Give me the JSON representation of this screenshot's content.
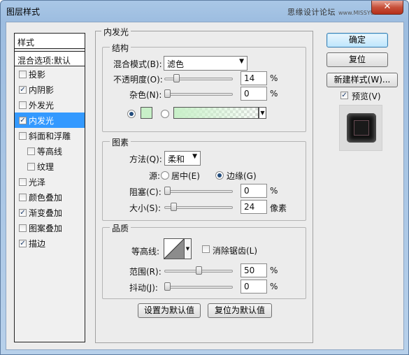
{
  "window": {
    "title": "图层样式",
    "watermark": "思缘设计论坛",
    "watermark_sub": "www.MISSYUAN.COM",
    "close_glyph": "✕"
  },
  "sidebar": {
    "header": "样式",
    "blend_header": "混合选项:默认",
    "items": [
      {
        "label": "投影",
        "checked": false,
        "selected": false,
        "check": ""
      },
      {
        "label": "内阴影",
        "checked": true,
        "selected": false,
        "check": "✓"
      },
      {
        "label": "外发光",
        "checked": false,
        "selected": false,
        "check": ""
      },
      {
        "label": "内发光",
        "checked": true,
        "selected": true,
        "check": "✓"
      },
      {
        "label": "斜面和浮雕",
        "checked": false,
        "selected": false,
        "check": ""
      },
      {
        "label": "等高线",
        "checked": false,
        "selected": false,
        "indent": true,
        "check": ""
      },
      {
        "label": "纹理",
        "checked": false,
        "selected": false,
        "indent": true,
        "check": ""
      },
      {
        "label": "光泽",
        "checked": false,
        "selected": false,
        "check": ""
      },
      {
        "label": "颜色叠加",
        "checked": false,
        "selected": false,
        "check": ""
      },
      {
        "label": "渐变叠加",
        "checked": true,
        "selected": false,
        "check": "✓"
      },
      {
        "label": "图案叠加",
        "checked": false,
        "selected": false,
        "check": ""
      },
      {
        "label": "描边",
        "checked": true,
        "selected": false,
        "check": "✓"
      }
    ]
  },
  "buttons": {
    "ok": "确定",
    "reset": "复位",
    "new_style": "新建样式(W)...",
    "preview_label": "预览(V)",
    "preview_checked": true,
    "preview_check": "✓",
    "set_default": "设置为默认值",
    "reset_default": "复位为默认值"
  },
  "panel": {
    "title": "内发光",
    "structure": {
      "title": "结构",
      "blend_mode_label": "混合模式(B):",
      "blend_mode_value": "滤色",
      "opacity_label": "不透明度(O):",
      "opacity_value": "14",
      "opacity_unit": "%",
      "opacity_fraction": 0.14,
      "noise_label": "杂色(N):",
      "noise_value": "0",
      "noise_unit": "%",
      "noise_fraction": 0,
      "color_mode": "solid",
      "glow_color": "#c8f0c8",
      "arrow_glyph": "▼"
    },
    "elements": {
      "title": "图素",
      "method_label": "方法(Q):",
      "method_value": "柔和",
      "source_label": "源:",
      "source_center": "居中(E)",
      "source_edge": "边缘(G)",
      "source_selected": "edge",
      "choke_label": "阻塞(C):",
      "choke_value": "0",
      "choke_unit": "%",
      "choke_fraction": 0,
      "size_label": "大小(S):",
      "size_value": "24",
      "size_unit": "像素",
      "size_fraction": 0.095
    },
    "quality": {
      "title": "品质",
      "contour_label": "等高线:",
      "anti_alias_label": "消除锯齿(L)",
      "anti_alias_checked": false,
      "range_label": "范围(R):",
      "range_value": "50",
      "range_unit": "%",
      "range_fraction": 0.5,
      "jitter_label": "抖动(J):",
      "jitter_value": "0",
      "jitter_unit": "%",
      "jitter_fraction": 0
    }
  }
}
